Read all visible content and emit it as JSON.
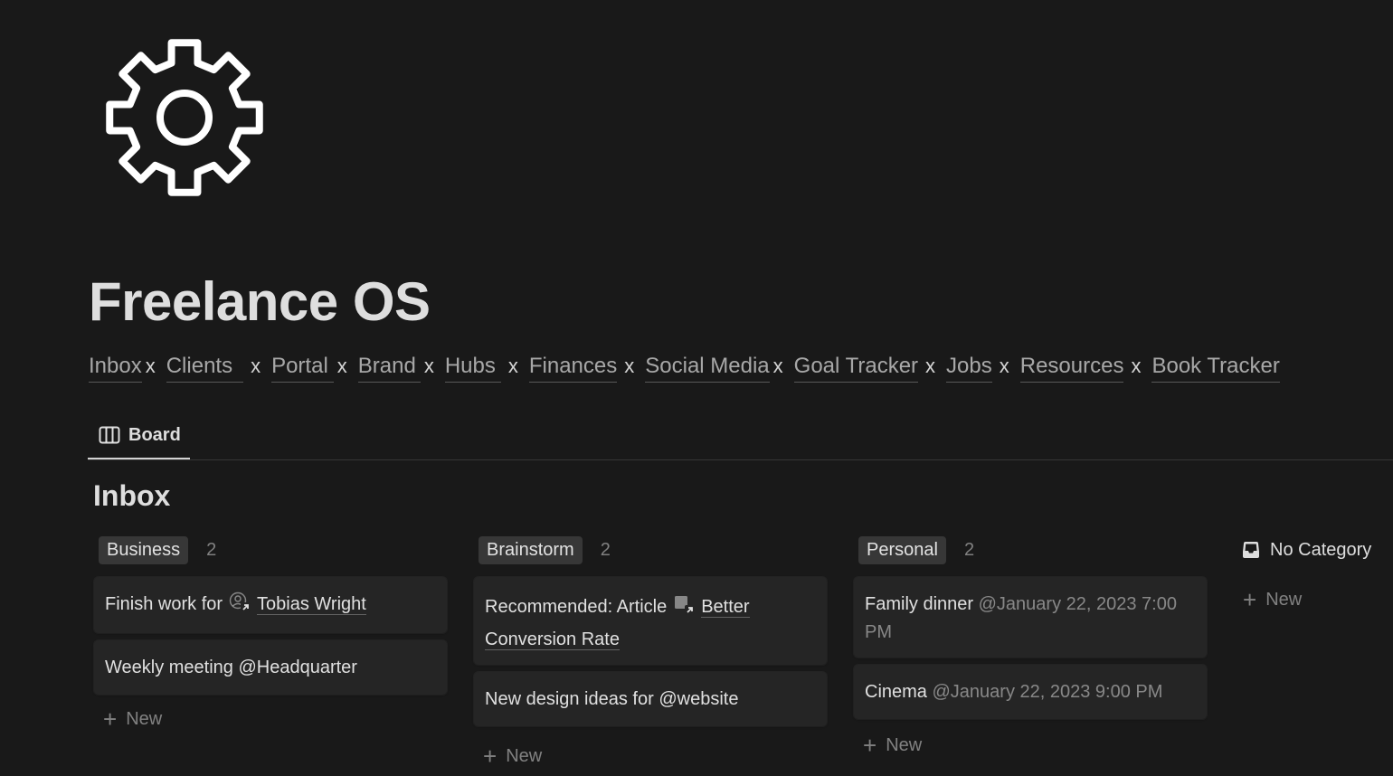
{
  "page": {
    "icon": "gear-icon",
    "title": "Freelance OS"
  },
  "nav_links": [
    {
      "label": "Inbox"
    },
    {
      "label": "Clients"
    },
    {
      "label": "Portal"
    },
    {
      "label": "Brand"
    },
    {
      "label": "Hubs"
    },
    {
      "label": "Finances"
    },
    {
      "label": "Social Media"
    },
    {
      "label": "Goal Tracker"
    },
    {
      "label": "Jobs"
    },
    {
      "label": "Resources"
    },
    {
      "label": "Book Tracker"
    }
  ],
  "nav_separator": "x",
  "view_tabs": [
    {
      "label": "Board",
      "icon": "board-view-icon",
      "active": true
    }
  ],
  "database": {
    "title": "Inbox"
  },
  "columns": [
    {
      "tag": "Business",
      "count": "2",
      "cards": [
        {
          "text": "Finish work for",
          "mention": "Tobias Wright",
          "mention_icon": "person-link-icon"
        },
        {
          "text": "Weekly meeting @Headquarter"
        }
      ],
      "new_label": "New"
    },
    {
      "tag": "Brainstorm",
      "count": "2",
      "cards": [
        {
          "text": "Recommended: Article",
          "mention": "Better Conversion Rate",
          "mention_icon": "page-link-icon"
        },
        {
          "text": "New design ideas for @website"
        }
      ],
      "new_label": "New"
    },
    {
      "tag": "Personal",
      "count": "2",
      "cards": [
        {
          "text": "Family dinner",
          "date": "@January 22, 2023 7:00 PM"
        },
        {
          "text": "Cinema",
          "date": "@January 22, 2023 9:00 PM"
        }
      ],
      "new_label": "New"
    }
  ],
  "no_category": {
    "label": "No Category",
    "icon": "inbox-tray-icon",
    "new_label": "New"
  }
}
